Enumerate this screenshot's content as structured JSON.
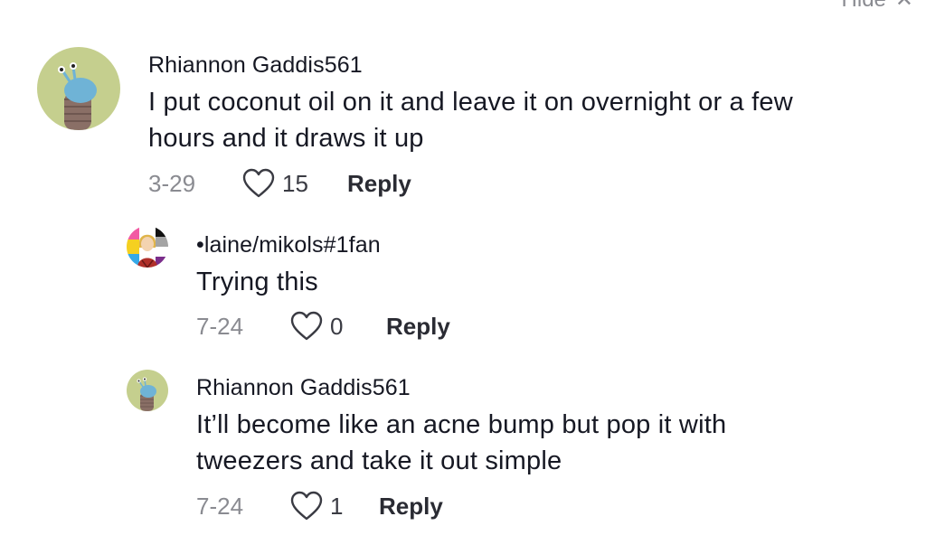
{
  "header": {
    "hide_label": "Hide",
    "close_glyph": "✕"
  },
  "comments": [
    {
      "username": "Rhiannon Gaddis561",
      "text_line1": "I put coconut oil on it and leave it on overnight or a few",
      "text_line2": "hours and it draws it up",
      "date": "3-29",
      "likes": "15",
      "reply_label": "Reply"
    },
    {
      "username": "•laine/mikols#1fan",
      "text_line1": "Trying this",
      "date": "7-24",
      "likes": "0",
      "reply_label": "Reply"
    },
    {
      "username": "Rhiannon Gaddis561",
      "text_line1": "It’ll become like an acne bump but pop it with",
      "text_line2": "tweezers and take it out simple",
      "date": "7-24",
      "likes": "1",
      "reply_label": "Reply"
    }
  ],
  "icons": {
    "like": "heart-outline-icon",
    "avatar_snail": "snail-avatar-icon",
    "avatar_character": "character-avatar-icon"
  },
  "colors": {
    "text": "#161823",
    "muted": "#8a8b91",
    "avatar_bg": "#c5cf8e",
    "snail_blue": "#6fb3d6"
  }
}
